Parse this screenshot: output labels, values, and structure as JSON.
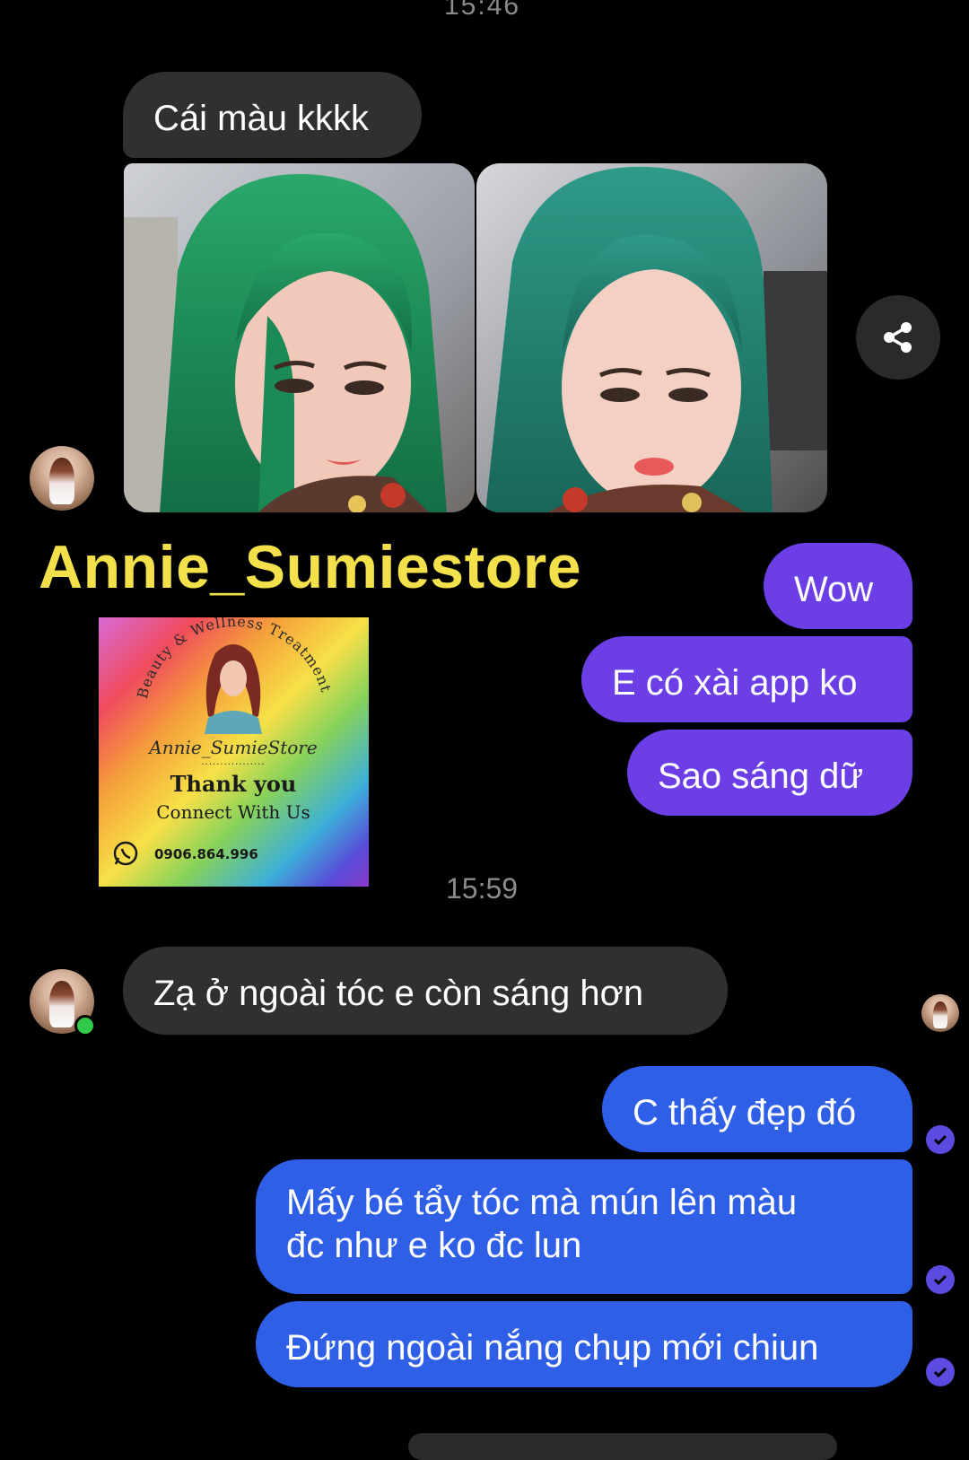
{
  "chat": {
    "top_time": "15:46",
    "mid_time": "15:59",
    "store_name": "Annie_Sumiestore",
    "incoming": [
      {
        "text": "Cái màu kkkk"
      },
      {
        "text": "Zạ ở ngoài tóc e còn sáng hơn"
      }
    ],
    "outgoing_purple": [
      {
        "text": "Wow"
      },
      {
        "text": "E có xài app ko"
      },
      {
        "text": "Sao sáng dữ"
      }
    ],
    "outgoing_blue": [
      {
        "text": "C thấy đẹp đó"
      },
      {
        "text_line1": "Mấy bé tẩy tóc mà mún lên màu",
        "text_line2": "đc như e ko đc lun"
      },
      {
        "text": "Đứng ngoài nắng chụp mới chiun"
      }
    ]
  },
  "card": {
    "arc_text": "Beauty & Wellness Treatment",
    "script_name": "Annie_SumieStore",
    "thank_you": "Thank you",
    "connect": "Connect With  Us",
    "phone": "0906.864.996"
  },
  "colors": {
    "incoming_bubble": "#303030",
    "outgoing_purple": "#6b3ee6",
    "outgoing_blue": "#2f5fe6",
    "store_name": "#f4e04a",
    "timestamp": "#8a8a8f",
    "online": "#31c94a"
  },
  "icons": {
    "share": "share-icon",
    "read_receipt": "check-circle-icon",
    "phone": "whatsapp-icon"
  }
}
